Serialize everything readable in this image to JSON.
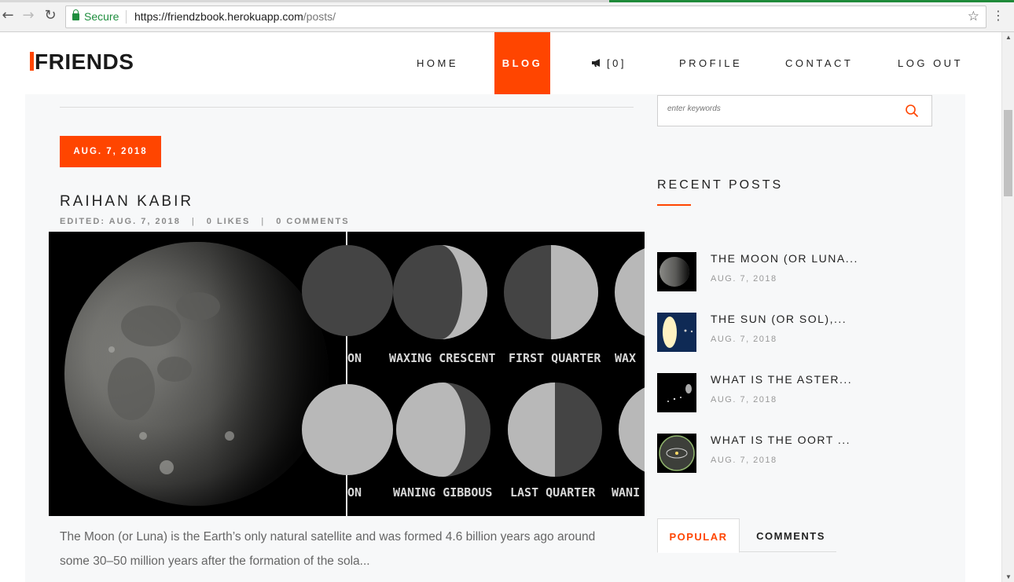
{
  "browser": {
    "secure_label": "Secure",
    "url_base": "https://friendzbook.herokuapp.com",
    "url_path": "/posts/",
    "back_icon": "back-arrow-icon",
    "forward_icon": "forward-arrow-icon",
    "reload_icon": "reload-icon"
  },
  "header": {
    "logo": "FRIENDS",
    "nav": {
      "home": "HOME",
      "blog": "BLOG",
      "notifications": "[0]",
      "profile": "PROFILE",
      "contact": "CONTACT",
      "logout": "LOG OUT"
    },
    "accent_color": "#ff4500"
  },
  "post": {
    "date": "AUG. 7, 2018",
    "author": "RAIHAN KABIR",
    "edited": "EDITED: AUG. 7, 2018",
    "likes": "0 LIKES",
    "comments": "0 COMMENTS",
    "phase_labels": {
      "top_left_partial": "ON",
      "waxing_crescent": "WAXING CRESCENT",
      "first_quarter": "FIRST QUARTER",
      "top_right_partial": "WAX",
      "bottom_left_partial": "ON",
      "waning_gibbous": "WANING GIBBOUS",
      "last_quarter": "LAST QUARTER",
      "bottom_right_partial": "WANI"
    },
    "excerpt": "The Moon (or Luna) is the Earth’s only natural satellite and was formed 4.6 billion years ago around some 30–50 million years after the formation of the sola..."
  },
  "sidebar": {
    "search_placeholder": "enter keywords",
    "recent_heading": "RECENT POSTS",
    "recent_posts": [
      {
        "title": "THE MOON (OR LUNA...",
        "date": "AUG. 7, 2018"
      },
      {
        "title": "THE SUN (OR SOL),...",
        "date": "AUG. 7, 2018"
      },
      {
        "title": "WHAT IS THE ASTER...",
        "date": "AUG. 7, 2018"
      },
      {
        "title": "WHAT IS THE OORT ...",
        "date": "AUG. 7, 2018"
      }
    ],
    "tabs": {
      "popular": "POPULAR",
      "comments": "COMMENTS"
    }
  }
}
